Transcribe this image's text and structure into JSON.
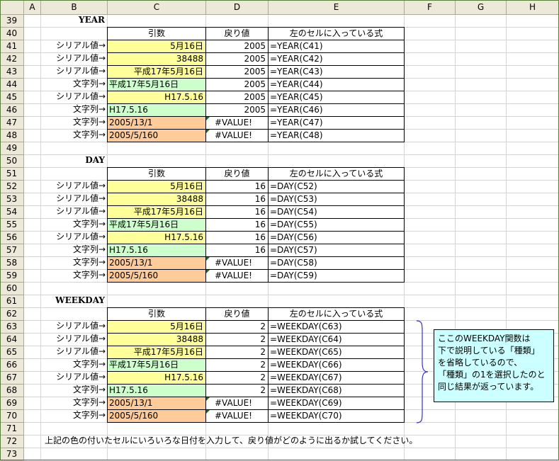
{
  "columns": [
    "A",
    "B",
    "C",
    "D",
    "E",
    "F",
    "G",
    "H"
  ],
  "rows": [
    "39",
    "40",
    "41",
    "42",
    "43",
    "44",
    "45",
    "46",
    "47",
    "48",
    "49",
    "50",
    "51",
    "52",
    "53",
    "54",
    "55",
    "56",
    "57",
    "58",
    "59",
    "60",
    "61",
    "62",
    "63",
    "64",
    "65",
    "66",
    "67",
    "68",
    "69",
    "70",
    "71",
    "72",
    "73"
  ],
  "sections": [
    {
      "title": "YEAR",
      "headers": {
        "arg": "引数",
        "ret": "戻り値",
        "formula": "左のセルに入っている式"
      },
      "items": [
        {
          "label": "シリアル値→",
          "arg": "5月16日",
          "ret": "2005",
          "formula": "=YEAR(C41)",
          "color": "yellow",
          "align": "right"
        },
        {
          "label": "シリアル値→",
          "arg": "38488",
          "ret": "2005",
          "formula": "=YEAR(C42)",
          "color": "yellow",
          "align": "right"
        },
        {
          "label": "シリアル値→",
          "arg": "平成17年5月16日",
          "ret": "2005",
          "formula": "=YEAR(C43)",
          "color": "yellow",
          "align": "right"
        },
        {
          "label": "文字列→",
          "arg": "平成17年5月16日",
          "ret": "2005",
          "formula": "=YEAR(C44)",
          "color": "green",
          "align": "left"
        },
        {
          "label": "シリアル値→",
          "arg": "H17.5.16",
          "ret": "2005",
          "formula": "=YEAR(C45)",
          "color": "yellow",
          "align": "right"
        },
        {
          "label": "文字列→",
          "arg": "H17.5.16",
          "ret": "2005",
          "formula": "=YEAR(C46)",
          "color": "green",
          "align": "left"
        },
        {
          "label": "文字列→",
          "arg": "2005/13/1",
          "ret": "#VALUE!",
          "formula": "=YEAR(C47)",
          "color": "orange",
          "align": "left"
        },
        {
          "label": "文字列→",
          "arg": "2005/5/160",
          "ret": "#VALUE!",
          "formula": "=YEAR(C48)",
          "color": "orange",
          "align": "left"
        }
      ]
    },
    {
      "title": "DAY",
      "headers": {
        "arg": "引数",
        "ret": "戻り値",
        "formula": "左のセルに入っている式"
      },
      "items": [
        {
          "label": "シリアル値→",
          "arg": "5月16日",
          "ret": "16",
          "formula": "=DAY(C52)",
          "color": "yellow",
          "align": "right"
        },
        {
          "label": "シリアル値→",
          "arg": "38488",
          "ret": "16",
          "formula": "=DAY(C53)",
          "color": "yellow",
          "align": "right"
        },
        {
          "label": "シリアル値→",
          "arg": "平成17年5月16日",
          "ret": "16",
          "formula": "=DAY(C54)",
          "color": "yellow",
          "align": "right"
        },
        {
          "label": "文字列→",
          "arg": "平成17年5月16日",
          "ret": "16",
          "formula": "=DAY(C55)",
          "color": "green",
          "align": "left"
        },
        {
          "label": "シリアル値→",
          "arg": "H17.5.16",
          "ret": "16",
          "formula": "=DAY(C56)",
          "color": "yellow",
          "align": "right"
        },
        {
          "label": "文字列→",
          "arg": "H17.5.16",
          "ret": "16",
          "formula": "=DAY(C57)",
          "color": "green",
          "align": "left"
        },
        {
          "label": "文字列→",
          "arg": "2005/13/1",
          "ret": "#VALUE!",
          "formula": "=DAY(C58)",
          "color": "orange",
          "align": "left"
        },
        {
          "label": "文字列→",
          "arg": "2005/5/160",
          "ret": "#VALUE!",
          "formula": "=DAY(C59)",
          "color": "orange",
          "align": "left"
        }
      ]
    },
    {
      "title": "WEEKDAY",
      "headers": {
        "arg": "引数",
        "ret": "戻り値",
        "formula": "左のセルに入っている式"
      },
      "items": [
        {
          "label": "シリアル値→",
          "arg": "5月16日",
          "ret": "2",
          "formula": "=WEEKDAY(C63)",
          "color": "yellow",
          "align": "right"
        },
        {
          "label": "シリアル値→",
          "arg": "38488",
          "ret": "2",
          "formula": "=WEEKDAY(C64)",
          "color": "yellow",
          "align": "right"
        },
        {
          "label": "シリアル値→",
          "arg": "平成17年5月16日",
          "ret": "2",
          "formula": "=WEEKDAY(C65)",
          "color": "yellow",
          "align": "right"
        },
        {
          "label": "文字列→",
          "arg": "平成17年5月16日",
          "ret": "2",
          "formula": "=WEEKDAY(C66)",
          "color": "green",
          "align": "left"
        },
        {
          "label": "シリアル値→",
          "arg": "H17.5.16",
          "ret": "2",
          "formula": "=WEEKDAY(C67)",
          "color": "yellow",
          "align": "right"
        },
        {
          "label": "文字列→",
          "arg": "H17.5.16",
          "ret": "2",
          "formula": "=WEEKDAY(C68)",
          "color": "green",
          "align": "left"
        },
        {
          "label": "文字列→",
          "arg": "2005/13/1",
          "ret": "#VALUE!",
          "formula": "=WEEKDAY(C69)",
          "color": "orange",
          "align": "left"
        },
        {
          "label": "文字列→",
          "arg": "2005/5/160",
          "ret": "#VALUE!",
          "formula": "=WEEKDAY(C70)",
          "color": "orange",
          "align": "left"
        }
      ]
    }
  ],
  "note_lines": [
    "ここのWEEKDAY関数は",
    "下で説明している「種類」",
    "を省略しているので、",
    "「種類」の1を選択したのと",
    "同じ結果が返っています。"
  ],
  "footer_text": "上記の色の付いたセルにいろいろな日付を入力して、戻り値がどのように出るか試してください。",
  "colors": {
    "yellow": "#ffff99",
    "green": "#ccffcc",
    "orange": "#ffcc99",
    "note": "#ccffff",
    "header_bg": "#ece9d8",
    "brace": "#3333cc",
    "error_marker": "#008000"
  }
}
